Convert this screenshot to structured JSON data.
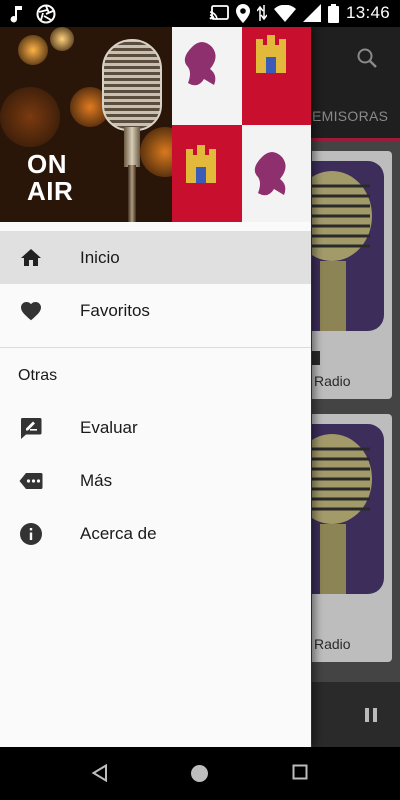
{
  "status_bar": {
    "time": "13:46",
    "icons": [
      "music-note-icon",
      "aperture-icon",
      "cast-icon",
      "location-icon",
      "wifi-icon",
      "signal-icon",
      "battery-icon"
    ]
  },
  "background": {
    "tab_label": "EMISORAS",
    "cards": [
      {
        "subtitle": "Radio"
      },
      {
        "subtitle": "Radio"
      }
    ]
  },
  "drawer": {
    "header_text": [
      "ON",
      "AIR"
    ],
    "items": [
      {
        "label": "Inicio",
        "icon": "home-icon",
        "active": true
      },
      {
        "label": "Favoritos",
        "icon": "heart-icon",
        "active": false
      }
    ],
    "section_title": "Otras",
    "other_items": [
      {
        "label": "Evaluar",
        "icon": "rate-review-icon"
      },
      {
        "label": "Más",
        "icon": "more-tag-icon"
      },
      {
        "label": "Acerca de",
        "icon": "info-icon"
      }
    ]
  },
  "colors": {
    "accent": "#a01a3a",
    "drawer_bg": "#fafafa",
    "active_item_bg": "#e0e0e0",
    "icon": "#333333"
  }
}
